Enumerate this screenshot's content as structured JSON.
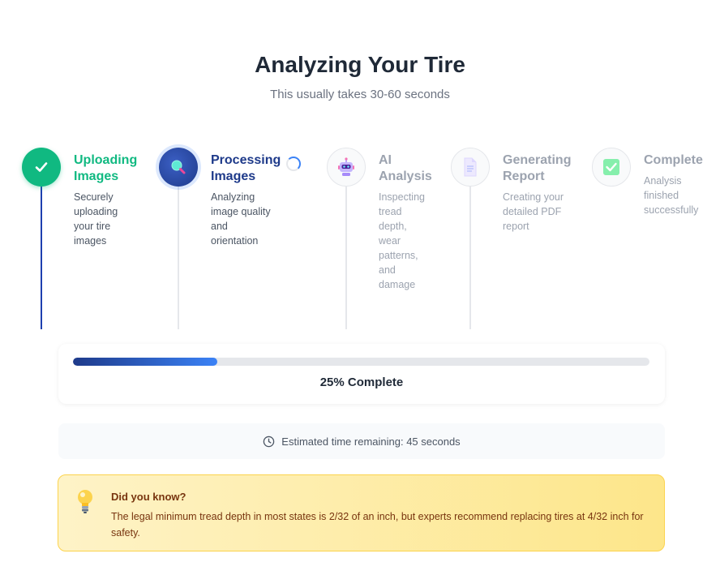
{
  "header": {
    "title": "Analyzing Your Tire",
    "subtitle": "This usually takes 30-60 seconds"
  },
  "steps": [
    {
      "title_line1": "Uploading",
      "title_line2": "Images",
      "desc": [
        "Securely",
        "uploading",
        "your tire",
        "images"
      ],
      "status": "done",
      "icon": "checkmark-icon"
    },
    {
      "title_line1": "Processing",
      "title_line2": "Images",
      "desc": [
        "Analyzing",
        "image quality",
        "and",
        "orientation"
      ],
      "status": "active",
      "icon": "magnifier-icon"
    },
    {
      "title_line1": "AI",
      "title_line2": "Analysis",
      "desc": [
        "Inspecting",
        "tread",
        "depth,",
        "wear",
        "patterns,",
        "and",
        "damage"
      ],
      "status": "pending",
      "icon": "robot-icon"
    },
    {
      "title_line1": "Generating",
      "title_line2": "Report",
      "desc": [
        "Creating your",
        "detailed PDF",
        "report"
      ],
      "status": "pending",
      "icon": "document-icon"
    },
    {
      "title_line1": "Complete",
      "title_line2": "",
      "desc": [
        "Analysis",
        "finished",
        "successfully"
      ],
      "status": "pending",
      "icon": "check-box-icon"
    }
  ],
  "progress": {
    "percent": 25,
    "label": "25% Complete"
  },
  "time_remaining": {
    "icon": "clock-icon",
    "text": "Estimated time remaining: 45 seconds"
  },
  "tip": {
    "icon": "lightbulb-icon",
    "title": "Did you know?",
    "text": "The legal minimum tread depth in most states is 2/32 of an inch, but experts recommend replacing tires at 4/32 inch for safety."
  },
  "colors": {
    "done": "#10b981",
    "active": "#1e3a8a",
    "pending": "#9ca3af",
    "accent": "#3b82f6"
  }
}
